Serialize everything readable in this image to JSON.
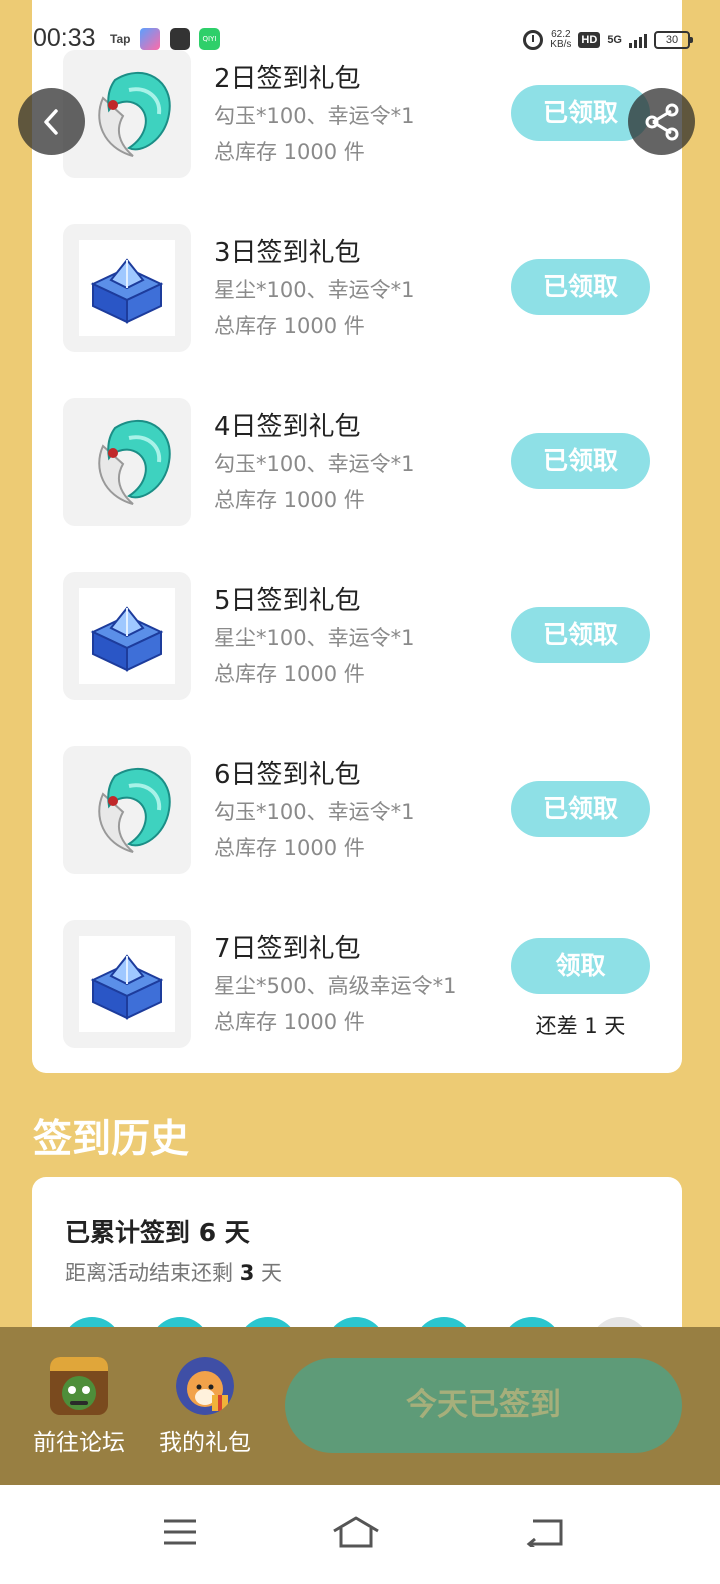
{
  "status_bar": {
    "time": "00:33",
    "tap_label": "Tap",
    "app3_label": "QIYI",
    "net_speed": "62.2",
    "net_unit": "KB/s",
    "hd": "HD",
    "network": "5G",
    "battery": "30"
  },
  "gifts": [
    {
      "title": "2日签到礼包",
      "desc": "勾玉*100、幸运令*1",
      "stock": "总库存 1000 件",
      "button": "已领取",
      "icon": "jade-magatama-icon"
    },
    {
      "title": "3日签到礼包",
      "desc": "星尘*100、幸运令*1",
      "stock": "总库存 1000 件",
      "button": "已领取",
      "icon": "blue-crystal-chest-icon"
    },
    {
      "title": "4日签到礼包",
      "desc": "勾玉*100、幸运令*1",
      "stock": "总库存 1000 件",
      "button": "已领取",
      "icon": "jade-magatama-icon"
    },
    {
      "title": "5日签到礼包",
      "desc": "星尘*100、幸运令*1",
      "stock": "总库存 1000 件",
      "button": "已领取",
      "icon": "blue-crystal-chest-icon"
    },
    {
      "title": "6日签到礼包",
      "desc": "勾玉*100、幸运令*1",
      "stock": "总库存 1000 件",
      "button": "已领取",
      "icon": "jade-magatama-icon"
    },
    {
      "title": "7日签到礼包",
      "desc": "星尘*500、高级幸运令*1",
      "stock": "总库存 1000 件",
      "button": "领取",
      "note": "还差 1 天",
      "icon": "blue-crystal-chest-icon"
    }
  ],
  "history": {
    "heading": "签到历史",
    "total": "已累计签到 6 天",
    "remain_prefix": "距离活动结束还剩",
    "remain_days": "3",
    "remain_suffix": "天",
    "days_checked": [
      true,
      true,
      true,
      true,
      true,
      true,
      false
    ]
  },
  "bottom_bar": {
    "forum_label": "前往论坛",
    "gifts_label": "我的礼包",
    "signin_label": "今天已签到"
  },
  "colors": {
    "background": "#EDCB74",
    "claimed_button": "#8EE0E6",
    "checked_dot": "#2BC6CF",
    "bottom_bar": "#987F42",
    "signin_button": "#5E9B78"
  }
}
